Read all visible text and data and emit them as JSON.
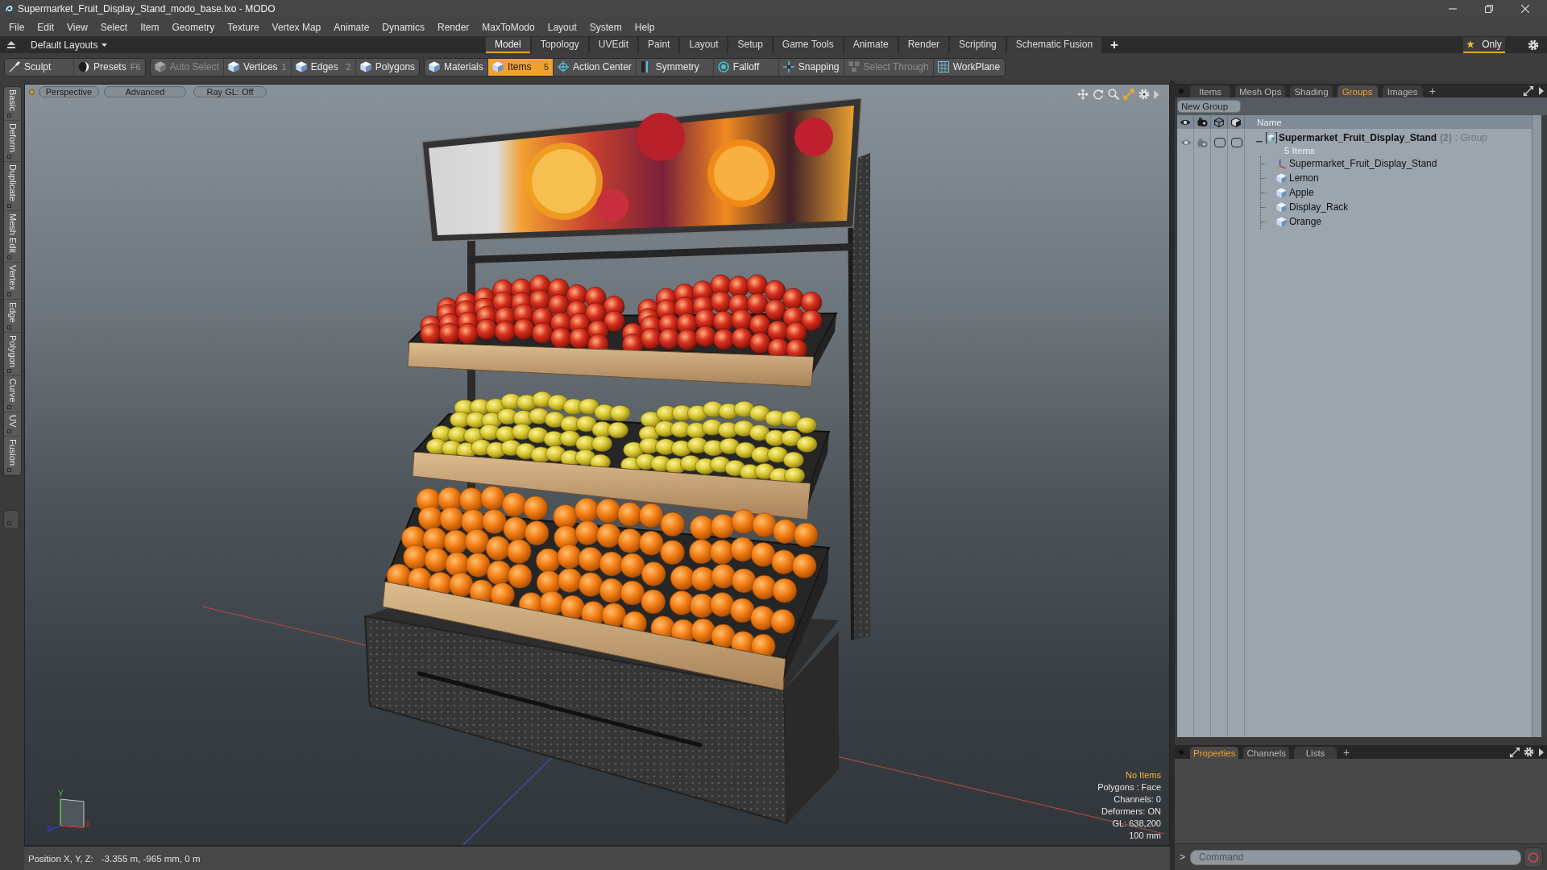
{
  "window": {
    "title": "Supermarket_Fruit_Display_Stand_modo_base.lxo - MODO"
  },
  "menu": [
    "File",
    "Edit",
    "View",
    "Select",
    "Item",
    "Geometry",
    "Texture",
    "Vertex Map",
    "Animate",
    "Dynamics",
    "Render",
    "MaxToModo",
    "Layout",
    "System",
    "Help"
  ],
  "layout_bar": {
    "layouts_menu": "Default Layouts",
    "tabs": [
      {
        "label": "Model",
        "selected": true
      },
      {
        "label": "Topology",
        "selected": false
      },
      {
        "label": "UVEdit",
        "selected": false
      },
      {
        "label": "Paint",
        "selected": false
      },
      {
        "label": "Layout",
        "selected": false
      },
      {
        "label": "Setup",
        "selected": false
      },
      {
        "label": "Game Tools",
        "selected": false
      },
      {
        "label": "Animate",
        "selected": false
      },
      {
        "label": "Render",
        "selected": false
      },
      {
        "label": "Scripting",
        "selected": false
      },
      {
        "label": "Schematic Fusion",
        "selected": false
      }
    ],
    "add": "+",
    "only": {
      "label": "Only",
      "on": true
    }
  },
  "toolbar": [
    {
      "items": [
        {
          "label": "Sculpt",
          "selected": false,
          "disabled": false
        },
        {
          "label": "Presets",
          "shortcut": "F6",
          "selected": false,
          "disabled": false
        }
      ]
    },
    {
      "items": [
        {
          "label": "Auto Select",
          "selected": false,
          "disabled": true
        },
        {
          "label": "Vertices",
          "shortcut": "1",
          "selected": false,
          "disabled": false
        },
        {
          "label": "Edges",
          "shortcut": "2",
          "selected": false,
          "disabled": false
        },
        {
          "label": "Polygons",
          "selected": false,
          "disabled": false
        }
      ]
    },
    {
      "items": [
        {
          "label": "Materials",
          "selected": false,
          "disabled": false
        },
        {
          "label": "Items",
          "shortcut": "5",
          "selected": true,
          "disabled": false
        },
        {
          "label": "Action Center",
          "selected": false,
          "disabled": false
        },
        {
          "label": "Symmetry",
          "selected": false,
          "disabled": false
        },
        {
          "label": "Falloff",
          "selected": false,
          "disabled": false
        },
        {
          "label": "Snapping",
          "selected": false,
          "disabled": false
        },
        {
          "label": "Select Through",
          "selected": false,
          "disabled": true
        },
        {
          "label": "WorkPlane",
          "selected": false,
          "disabled": false
        }
      ]
    }
  ],
  "side_tabs": [
    "Basic",
    "Deform",
    "Duplicate",
    "Mesh Edit",
    "Vertex",
    "Edge",
    "Polygon",
    "Curve",
    "UV",
    "Fusion"
  ],
  "viewport": {
    "view_buttons": [
      "Perspective",
      "Advanced",
      "Ray GL: Off"
    ],
    "gizmo": {
      "x": "X",
      "y": "Y",
      "z": "Z"
    },
    "info": [
      {
        "text": "No Items",
        "kind": "highlight"
      },
      {
        "text": "Polygons : Face",
        "kind": "plain"
      },
      {
        "text": "Channels: 0",
        "kind": "plain"
      },
      {
        "text": "Deformers: ON",
        "kind": "plain"
      },
      {
        "text": "GL: 638,200",
        "kind": "plain"
      },
      {
        "text": "100 mm",
        "kind": "plain"
      }
    ]
  },
  "status_bar": {
    "label": "Position X, Y, Z:",
    "value": "-3.355 m, -965 mm, 0 m"
  },
  "item_panel": {
    "tabs": [
      {
        "label": "Items",
        "selected": false
      },
      {
        "label": "Mesh Ops",
        "selected": false
      },
      {
        "label": "Shading",
        "selected": false
      },
      {
        "label": "Groups",
        "selected": true
      },
      {
        "label": "Images",
        "selected": false
      }
    ],
    "add": "+",
    "new_group": "New Group",
    "name_column": "Name",
    "group": {
      "name": "Supermarket_Fruit_Display_Stand",
      "count": "(2)",
      "type": ": Group",
      "summary": "5 Items",
      "expanded": true,
      "children": [
        {
          "name": "Supermarket_Fruit_Display_Stand",
          "kind": "locator"
        },
        {
          "name": "Lemon",
          "kind": "mesh"
        },
        {
          "name": "Apple",
          "kind": "mesh"
        },
        {
          "name": "Display_Rack",
          "kind": "mesh"
        },
        {
          "name": "Orange",
          "kind": "mesh"
        }
      ]
    }
  },
  "properties_panel": {
    "tabs": [
      {
        "label": "Properties",
        "selected": true
      },
      {
        "label": "Channels",
        "selected": false
      },
      {
        "label": "Lists",
        "selected": false
      }
    ],
    "add": "+"
  },
  "command": {
    "prompt": ">",
    "placeholder": "Command"
  }
}
